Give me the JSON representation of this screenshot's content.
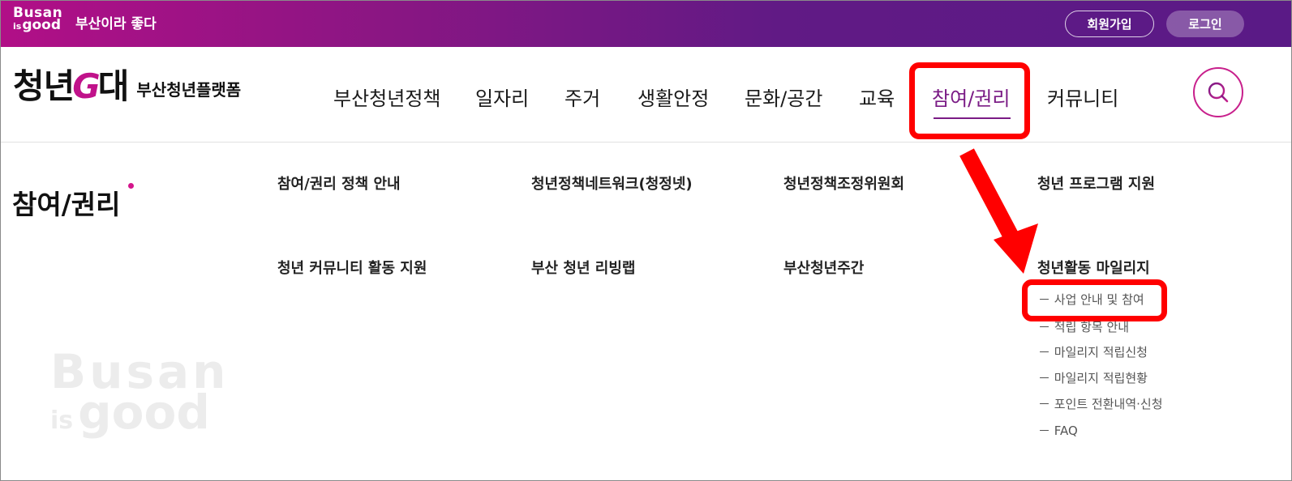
{
  "topbar": {
    "logo_line1": "Busan",
    "logo_is": "is",
    "logo_good": "good",
    "slogan": "부산이라 좋다",
    "join_label": "회원가입",
    "login_label": "로그인"
  },
  "brand": {
    "mark_left": "청년",
    "mark_g": "G",
    "mark_right": "대",
    "subtitle": "부산청년플랫폼"
  },
  "nav": {
    "items": [
      "부산청년정책",
      "일자리",
      "주거",
      "생활안정",
      "문화/공간",
      "교육",
      "참여/권리",
      "커뮤니티"
    ],
    "active_index": 6
  },
  "search": {
    "icon": "search-icon"
  },
  "megamenu": {
    "section_title": "참여/권리",
    "row1": [
      "참여/권리 정책 안내",
      "청년정책네트워크(청정넷)",
      "청년정책조정위원회",
      "청년 프로그램 지원"
    ],
    "row2": [
      "청년 커뮤니티 활동 지원",
      "부산 청년 리빙랩",
      "부산청년주간",
      "청년활동 마일리지"
    ],
    "mileage_sub": [
      "－ 사업 안내 및 참여",
      "－ 적립 항목 안내",
      "－ 마일리지 적립신청",
      "－ 마일리지 적립현황",
      "－ 포인트 전환내역·신청",
      "－ FAQ"
    ]
  },
  "watermark": {
    "line1": "Busan",
    "is": "is",
    "good": "good"
  },
  "colors": {
    "brand_purple": "#7a1b85",
    "brand_magenta": "#c0128a",
    "annotation_red": "#ff0000"
  }
}
